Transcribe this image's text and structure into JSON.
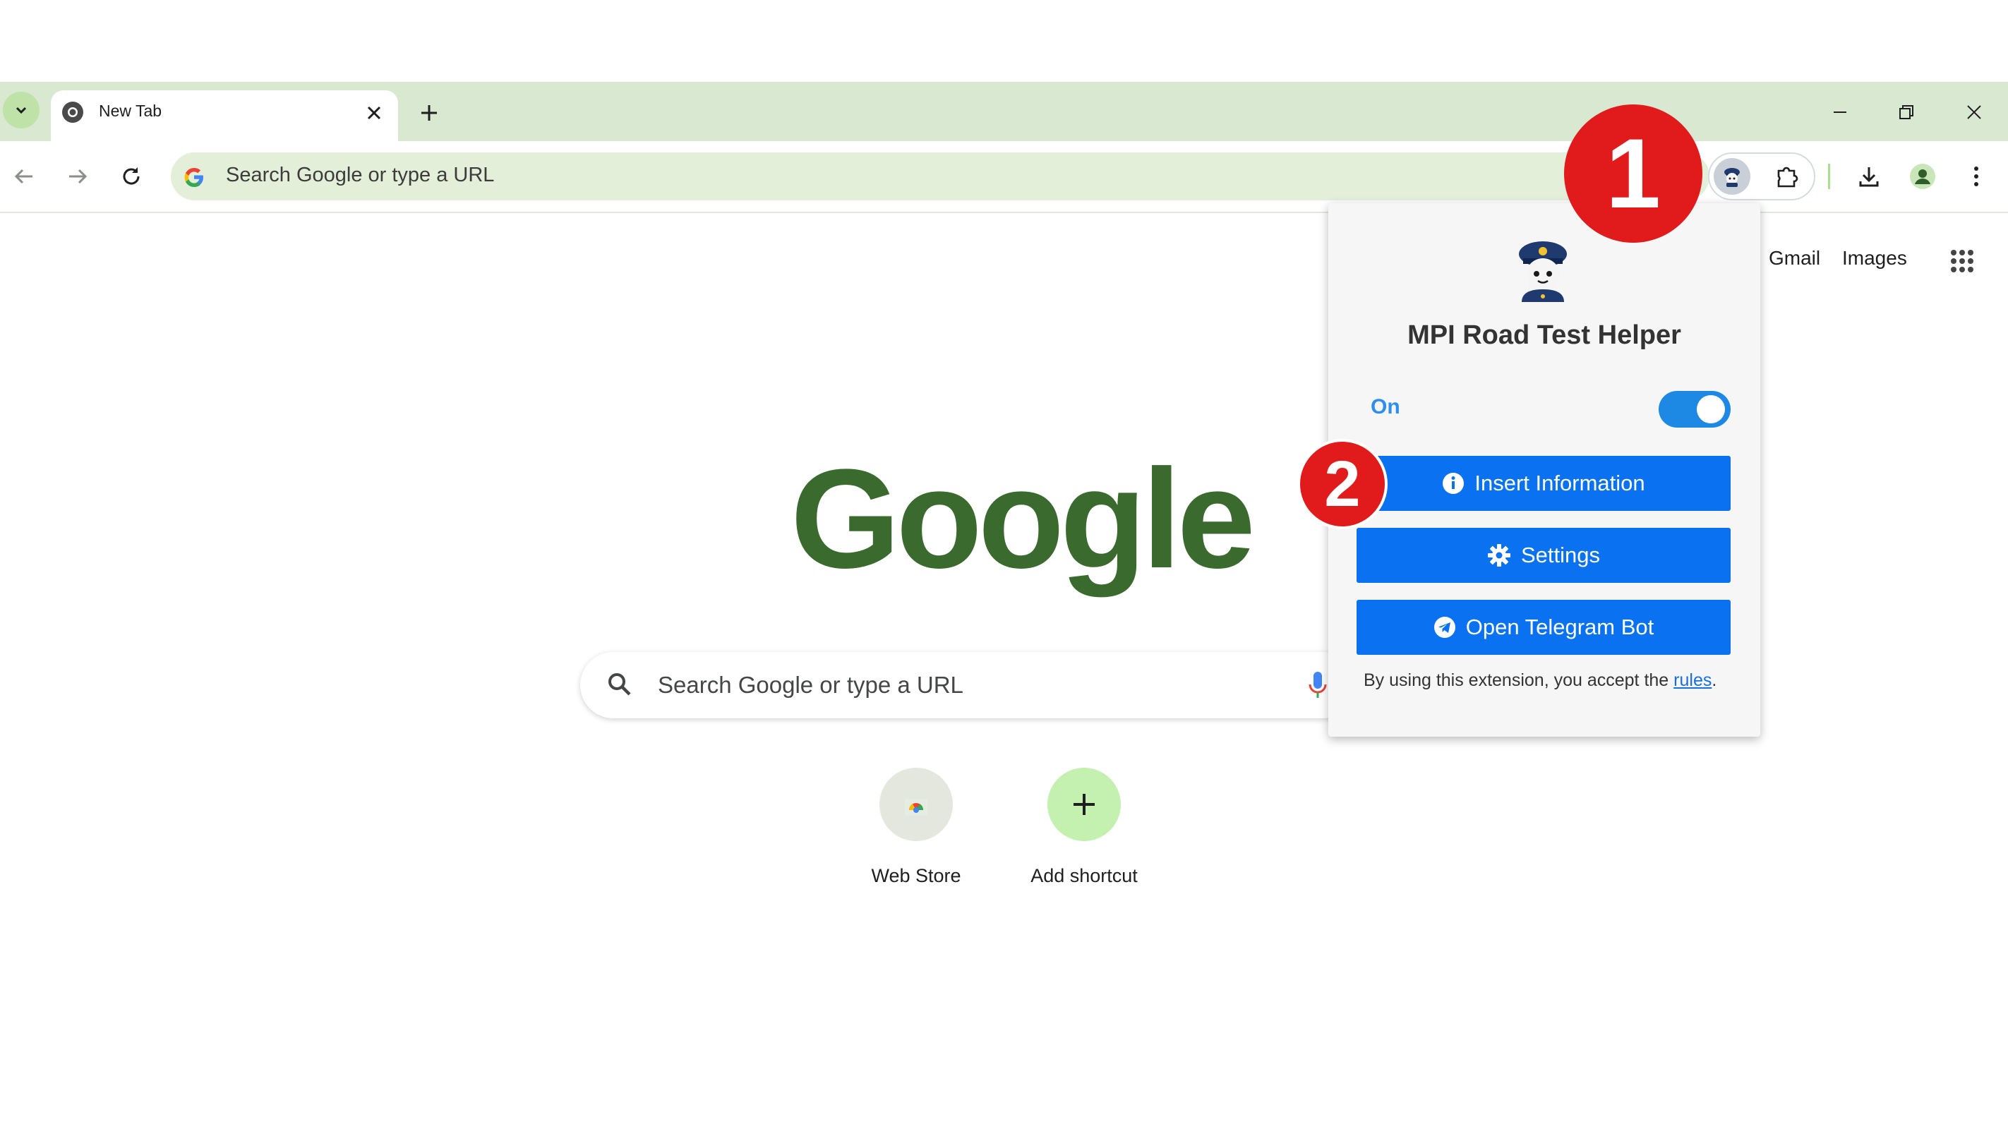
{
  "browser": {
    "tab_title": "New Tab",
    "new_tab_symbol": "+",
    "omnibox_placeholder": "Search Google or type a URL",
    "icons": [
      "tab-search-icon",
      "chrome-icon",
      "close-icon",
      "plus-icon",
      "minimize-icon",
      "restore-icon",
      "window-close-icon",
      "back-arrow-icon",
      "forward-arrow-icon",
      "reload-icon",
      "google-g-icon",
      "extension-icon",
      "puzzle-icon",
      "download-icon",
      "profile-icon",
      "kebab-menu-icon"
    ]
  },
  "page": {
    "top_links": [
      "Gmail",
      "Images"
    ],
    "logo_text": "Google",
    "logo_color": "#3a6a2d",
    "search_placeholder": "Search Google or type a URL",
    "shortcuts": [
      {
        "label": "Web Store",
        "icon": "webstore-icon"
      },
      {
        "label": "Add shortcut",
        "icon": "plus-icon",
        "symbol": "+"
      }
    ]
  },
  "popup": {
    "title": "MPI Road Test Helper",
    "toggle_label": "On",
    "toggle_state": true,
    "buttons": [
      {
        "label": "Insert Information",
        "icon": "info-icon"
      },
      {
        "label": "Settings",
        "icon": "gear-icon"
      },
      {
        "label": "Open Telegram Bot",
        "icon": "telegram-icon"
      }
    ],
    "accept_prefix": "By using this extension, you accept the ",
    "accept_link": "rules",
    "accept_suffix": ".",
    "accent_color": "#0a72f0"
  },
  "annotations": {
    "badges": [
      "1",
      "2"
    ],
    "badge_color": "#e11b1b"
  }
}
